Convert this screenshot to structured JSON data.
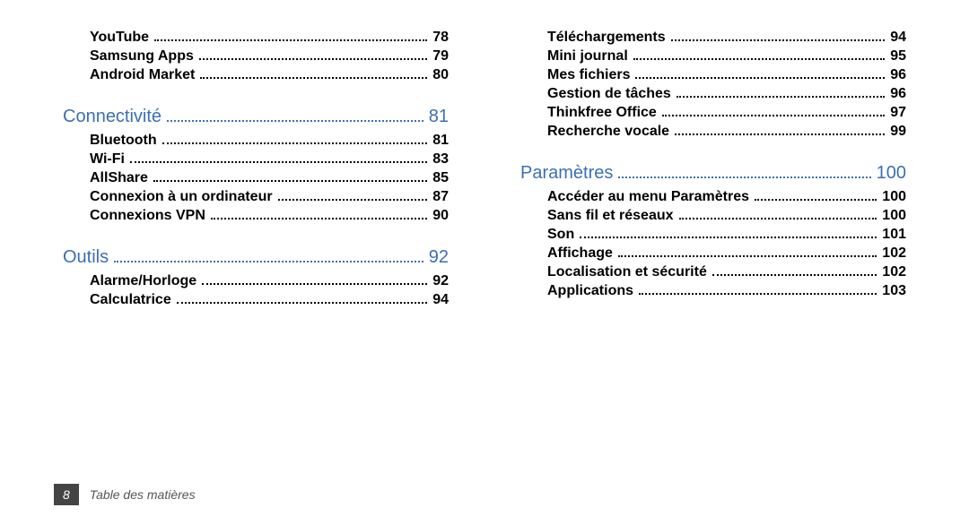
{
  "columns": [
    {
      "items": [
        {
          "type": "entry",
          "label": "YouTube",
          "page": "78"
        },
        {
          "type": "entry",
          "label": "Samsung Apps",
          "page": "79"
        },
        {
          "type": "entry",
          "label": "Android Market",
          "page": "80"
        },
        {
          "type": "section",
          "label": "Connectivité",
          "page": "81"
        },
        {
          "type": "entry",
          "label": "Bluetooth",
          "page": "81"
        },
        {
          "type": "entry",
          "label": "Wi-Fi",
          "page": "83"
        },
        {
          "type": "entry",
          "label": "AllShare",
          "page": "85"
        },
        {
          "type": "entry",
          "label": "Connexion à un ordinateur",
          "page": "87"
        },
        {
          "type": "entry",
          "label": "Connexions VPN",
          "page": "90"
        },
        {
          "type": "section",
          "label": "Outils",
          "page": "92"
        },
        {
          "type": "entry",
          "label": "Alarme/Horloge",
          "page": "92"
        },
        {
          "type": "entry",
          "label": "Calculatrice",
          "page": "94"
        }
      ]
    },
    {
      "items": [
        {
          "type": "entry",
          "label": "Téléchargements",
          "page": "94"
        },
        {
          "type": "entry",
          "label": "Mini journal",
          "page": "95"
        },
        {
          "type": "entry",
          "label": "Mes fichiers",
          "page": "96"
        },
        {
          "type": "entry",
          "label": "Gestion de tâches",
          "page": "96"
        },
        {
          "type": "entry",
          "label": "Thinkfree Office",
          "page": "97"
        },
        {
          "type": "entry",
          "label": "Recherche vocale",
          "page": "99"
        },
        {
          "type": "section",
          "label": "Paramètres",
          "page": "100"
        },
        {
          "type": "entry",
          "label": "Accéder au menu Paramètres",
          "page": "100"
        },
        {
          "type": "entry",
          "label": "Sans fil et réseaux",
          "page": "100"
        },
        {
          "type": "entry",
          "label": "Son",
          "page": "101"
        },
        {
          "type": "entry",
          "label": "Affichage",
          "page": "102"
        },
        {
          "type": "entry",
          "label": "Localisation et sécurité",
          "page": "102"
        },
        {
          "type": "entry",
          "label": "Applications",
          "page": "103"
        }
      ]
    }
  ],
  "footer": {
    "page_number": "8",
    "title": "Table des matières"
  }
}
